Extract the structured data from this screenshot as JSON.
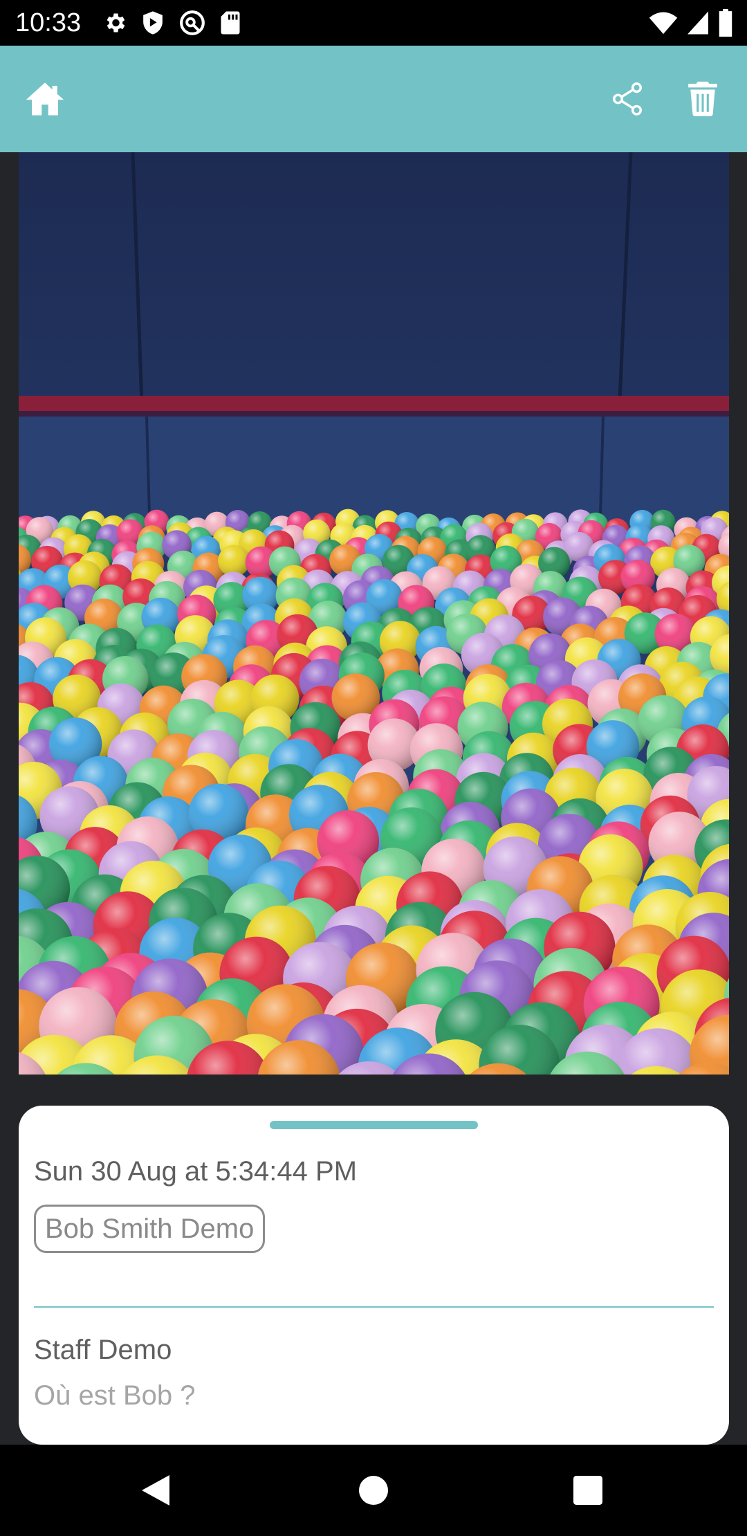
{
  "status_bar": {
    "time": "10:33",
    "left_icons": [
      "settings-icon",
      "play-protect-icon",
      "vpn-key-icon",
      "sd-card-icon"
    ],
    "right_icons": [
      "wifi-icon",
      "cellular-signal-icon",
      "battery-icon"
    ]
  },
  "app_bar": {
    "background": "#73c3c6",
    "icons": [
      "home-icon",
      "share-icon",
      "delete-icon"
    ]
  },
  "photo": {
    "subject": "ball-pit-photo"
  },
  "card": {
    "date": "Sun 30 Aug at 5:34:44 PM",
    "person_chip": "Bob Smith Demo",
    "staff": "Staff Demo",
    "question": "Où est Bob ?"
  },
  "nav_bar": {
    "icons": [
      "back-icon",
      "home-circle-icon",
      "recents-icon"
    ]
  },
  "colors": {
    "accent": "#73c3c6",
    "background": "#232528"
  }
}
